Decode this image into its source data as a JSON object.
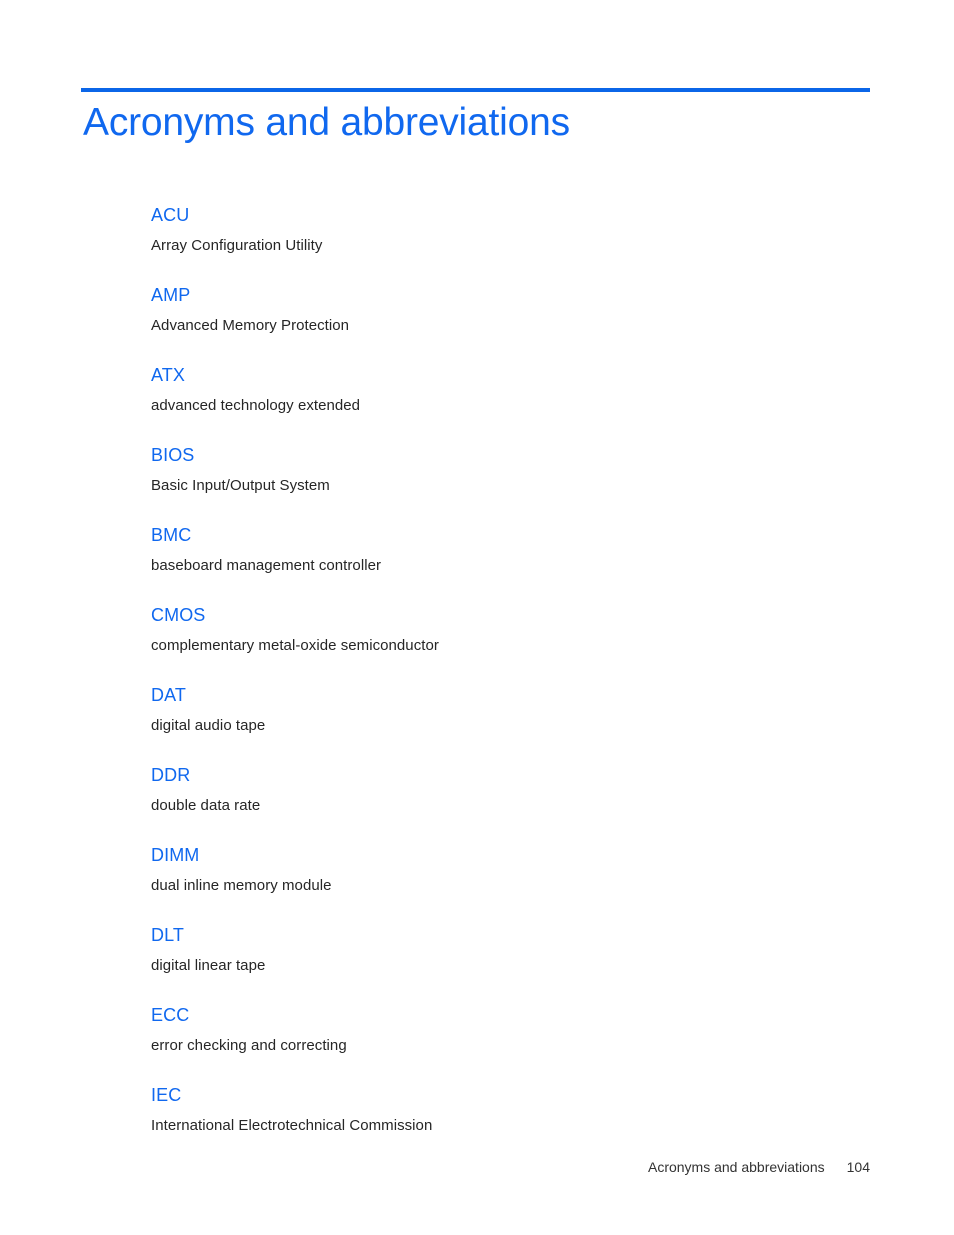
{
  "document": {
    "title": "Acronyms and abbreviations",
    "accent_color": "#1068ef",
    "rule_color": "#0b66e8",
    "body_text_color": "#262626",
    "background_color": "#ffffff"
  },
  "glossary": {
    "entries": [
      {
        "term": "ACU",
        "definition": "Array Configuration Utility"
      },
      {
        "term": "AMP",
        "definition": "Advanced Memory Protection"
      },
      {
        "term": "ATX",
        "definition": "advanced technology extended"
      },
      {
        "term": "BIOS",
        "definition": "Basic Input/Output System"
      },
      {
        "term": "BMC",
        "definition": "baseboard management controller"
      },
      {
        "term": "CMOS",
        "definition": "complementary metal-oxide semiconductor"
      },
      {
        "term": "DAT",
        "definition": "digital audio tape"
      },
      {
        "term": "DDR",
        "definition": "double data rate"
      },
      {
        "term": "DIMM",
        "definition": "dual inline memory module"
      },
      {
        "term": "DLT",
        "definition": "digital linear tape"
      },
      {
        "term": "ECC",
        "definition": "error checking and correcting"
      },
      {
        "term": "IEC",
        "definition": "International Electrotechnical Commission"
      }
    ]
  },
  "footer": {
    "chapter": "Acronyms and abbreviations",
    "page_number": "104"
  }
}
